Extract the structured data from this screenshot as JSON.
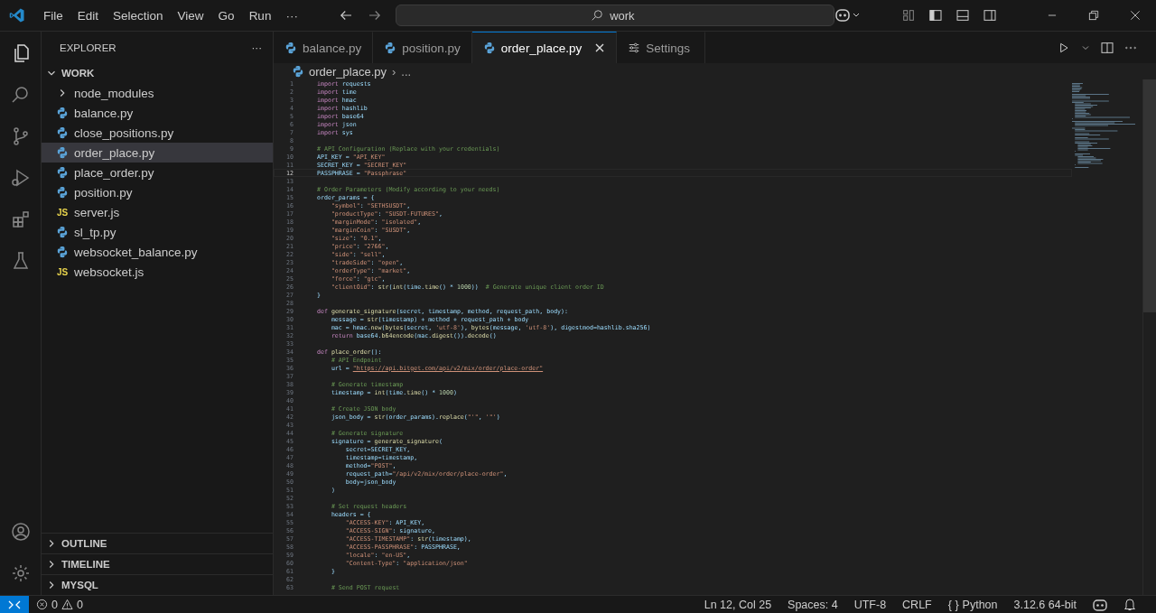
{
  "title_bar": {
    "menus": [
      "File",
      "Edit",
      "Selection",
      "View",
      "Go",
      "Run"
    ],
    "more": "···",
    "search": {
      "value": "work"
    }
  },
  "sidebar": {
    "title": "EXPLORER",
    "more": "···",
    "section": {
      "label": "WORK",
      "expanded": true
    },
    "items": [
      {
        "label": "node_modules",
        "kind": "folder",
        "selected": false,
        "expanded": false
      },
      {
        "label": "balance.py",
        "kind": "python",
        "selected": false
      },
      {
        "label": "close_positions.py",
        "kind": "python",
        "selected": false
      },
      {
        "label": "order_place.py",
        "kind": "python",
        "selected": true
      },
      {
        "label": "place_order.py",
        "kind": "python",
        "selected": false
      },
      {
        "label": "position.py",
        "kind": "python",
        "selected": false
      },
      {
        "label": "server.js",
        "kind": "js",
        "badge": "JS",
        "selected": false
      },
      {
        "label": "sl_tp.py",
        "kind": "python",
        "selected": false
      },
      {
        "label": "websocket_balance.py",
        "kind": "python",
        "selected": false
      },
      {
        "label": "websocket.js",
        "kind": "js",
        "badge": "JS",
        "selected": false
      }
    ],
    "panels": [
      {
        "label": "OUTLINE",
        "expanded": false
      },
      {
        "label": "TIMELINE",
        "expanded": false
      },
      {
        "label": "MYSQL",
        "expanded": false
      }
    ]
  },
  "tabs": [
    {
      "label": "balance.py",
      "kind": "python",
      "selected": false
    },
    {
      "label": "position.py",
      "kind": "python",
      "selected": false
    },
    {
      "label": "order_place.py",
      "kind": "python",
      "selected": true
    },
    {
      "label": "Settings",
      "kind": "settings",
      "selected": false
    }
  ],
  "breadcrumb": {
    "file": "order_place.py",
    "separator": "›",
    "rest": "..."
  },
  "code": [
    {
      "n": "1",
      "text": "import requests",
      "current": false
    },
    {
      "n": "2",
      "text": "import time",
      "current": false
    },
    {
      "n": "3",
      "text": "import hmac",
      "current": false
    },
    {
      "n": "4",
      "text": "import hashlib",
      "current": false
    },
    {
      "n": "5",
      "text": "import base64",
      "current": false
    },
    {
      "n": "6",
      "text": "import json",
      "current": false
    },
    {
      "n": "7",
      "text": "import sys",
      "current": false
    },
    {
      "n": "8",
      "current": false
    },
    {
      "n": "9",
      "text": "# API Configuration (Replace with your credentials)",
      "current": false
    },
    {
      "n": "10",
      "text": "API_KEY = \"API_KEY\"",
      "current": false
    },
    {
      "n": "11",
      "text": "SECRET_KEY = \"SECRET_KEY\"",
      "current": false
    },
    {
      "n": "12",
      "text": "PASSPHRASE = \"Passphrase\"",
      "current": true
    },
    {
      "n": "13",
      "current": false
    },
    {
      "n": "14",
      "text": "# Order Parameters (Modify according to your needs)",
      "current": false
    },
    {
      "n": "15",
      "text": "order_params = {",
      "current": false
    },
    {
      "n": "16",
      "text": "    \"symbol\": \"SETHSUSDT\",",
      "current": false
    },
    {
      "n": "17",
      "text": "    \"productType\": \"SUSDT-FUTURES\",",
      "current": false
    },
    {
      "n": "18",
      "text": "    \"marginMode\": \"isolated\",",
      "current": false
    },
    {
      "n": "19",
      "text": "    \"marginCoin\": \"SUSDT\",",
      "current": false
    },
    {
      "n": "20",
      "text": "    \"size\": \"0.1\",",
      "current": false
    },
    {
      "n": "21",
      "text": "    \"price\": \"2766\",",
      "current": false
    },
    {
      "n": "22",
      "text": "    \"side\": \"sell\",",
      "current": false
    },
    {
      "n": "23",
      "text": "    \"tradeSide\": \"open\",",
      "current": false
    },
    {
      "n": "24",
      "text": "    \"orderType\": \"market\",",
      "current": false
    },
    {
      "n": "25",
      "text": "    \"force\": \"gtc\",",
      "current": false
    },
    {
      "n": "26",
      "text": "    \"clientOid\": str(int(time.time() * 1000))  # Generate unique client order ID",
      "current": false
    },
    {
      "n": "27",
      "text": "}",
      "current": false
    },
    {
      "n": "28",
      "current": false
    },
    {
      "n": "29",
      "text": "def generate_signature(secret, timestamp, method, request_path, body):",
      "current": false
    },
    {
      "n": "30",
      "text": "    message = str(timestamp) + method + request_path + body",
      "current": false
    },
    {
      "n": "31",
      "text": "    mac = hmac.new(bytes(secret, 'utf-8'), bytes(message, 'utf-8'), digestmod=hashlib.sha256)",
      "current": false
    },
    {
      "n": "32",
      "text": "    return base64.b64encode(mac.digest()).decode()",
      "current": false
    },
    {
      "n": "33",
      "current": false
    },
    {
      "n": "34",
      "text": "def place_order():",
      "current": false
    },
    {
      "n": "35",
      "text": "    # API Endpoint",
      "current": false
    },
    {
      "n": "36",
      "text": "    url = \"https://api.bitget.com/api/v2/mix/order/place-order\"",
      "current": false
    },
    {
      "n": "37",
      "current": false
    },
    {
      "n": "38",
      "text": "    # Generate timestamp",
      "current": false
    },
    {
      "n": "39",
      "text": "    timestamp = int(time.time() * 1000)",
      "current": false
    },
    {
      "n": "40",
      "current": false
    },
    {
      "n": "41",
      "text": "    # Create JSON body",
      "current": false
    },
    {
      "n": "42",
      "text": "    json_body = str(order_params).replace(\"'\", '\"')",
      "current": false
    },
    {
      "n": "43",
      "current": false
    },
    {
      "n": "44",
      "text": "    # Generate signature",
      "current": false
    },
    {
      "n": "45",
      "text": "    signature = generate_signature(",
      "current": false
    },
    {
      "n": "46",
      "text": "        secret=SECRET_KEY,",
      "current": false
    },
    {
      "n": "47",
      "text": "        timestamp=timestamp,",
      "current": false
    },
    {
      "n": "48",
      "text": "        method=\"POST\",",
      "current": false
    },
    {
      "n": "49",
      "text": "        request_path=\"/api/v2/mix/order/place-order\",",
      "current": false
    },
    {
      "n": "50",
      "text": "        body=json_body",
      "current": false
    },
    {
      "n": "51",
      "text": "    )",
      "current": false
    },
    {
      "n": "52",
      "current": false
    },
    {
      "n": "53",
      "text": "    # Set request headers",
      "current": false
    },
    {
      "n": "54",
      "text": "    headers = {",
      "current": false
    },
    {
      "n": "55",
      "text": "        \"ACCESS-KEY\": API_KEY,",
      "current": false
    },
    {
      "n": "56",
      "text": "        \"ACCESS-SIGN\": signature,",
      "current": false
    },
    {
      "n": "57",
      "text": "        \"ACCESS-TIMESTAMP\": str(timestamp),",
      "current": false
    },
    {
      "n": "58",
      "text": "        \"ACCESS-PASSPHRASE\": PASSPHRASE,",
      "current": false
    },
    {
      "n": "59",
      "text": "        \"locale\": \"en-US\",",
      "current": false
    },
    {
      "n": "60",
      "text": "        \"Content-Type\": \"application/json\"",
      "current": false
    },
    {
      "n": "61",
      "text": "    }",
      "current": false
    },
    {
      "n": "62",
      "current": false
    },
    {
      "n": "63",
      "text": "    # Send POST request",
      "current": false
    }
  ],
  "status_bar": {
    "errors": "0",
    "warnings": "0",
    "items": [
      "Ln 12, Col 25",
      "Spaces: 4",
      "UTF-8",
      "CRLF",
      "Python",
      "3.12.6 64-bit"
    ],
    "braces": "{ }"
  }
}
